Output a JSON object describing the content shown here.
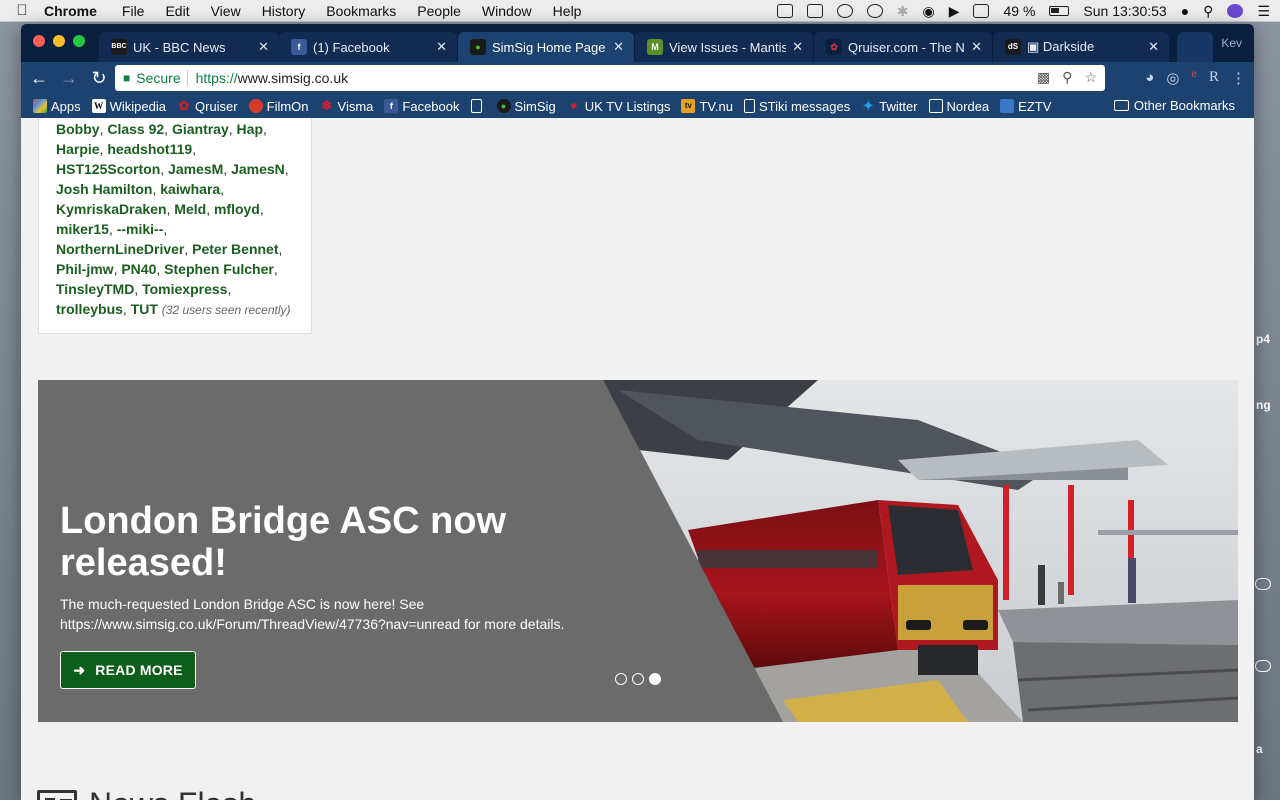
{
  "menubar": {
    "app": "Chrome",
    "items": [
      "File",
      "Edit",
      "View",
      "History",
      "Bookmarks",
      "People",
      "Window",
      "Help"
    ],
    "battery": "49 %",
    "clock": "Sun 13:30:53"
  },
  "tabs": [
    {
      "label": "UK - BBC News",
      "fav": "BBC",
      "color": "#1a1a1a"
    },
    {
      "label": "(1) Facebook",
      "fav": "f",
      "color": "#3b5998"
    },
    {
      "label": "SimSig Home Page | S",
      "fav": "●",
      "color": "#1a1a1a"
    },
    {
      "label": "View Issues - MantisB",
      "fav": "M",
      "color": "#5a8f2a"
    },
    {
      "label": "Qruiser.com - The No",
      "fav": "✿",
      "color": "#c0202a"
    },
    {
      "label": "▣ Darkside",
      "fav": "dS",
      "color": "#1a1a1a"
    }
  ],
  "profile": "Kev",
  "toolbar": {
    "secure": "Secure",
    "url_scheme": "https://",
    "url_rest": "www.simsig.co.uk"
  },
  "bookmarks": [
    {
      "label": "Apps",
      "icon": "apps-icon",
      "color": "#e04a3a"
    },
    {
      "label": "Wikipedia",
      "icon": "wikipedia-icon",
      "color": "#ffffff"
    },
    {
      "label": "Qruiser",
      "icon": "qruiser-icon",
      "color": "#c0202a"
    },
    {
      "label": "FilmOn",
      "icon": "filmon-icon",
      "color": "#d83a2a"
    },
    {
      "label": "Visma",
      "icon": "visma-icon",
      "color": "#d0203a"
    },
    {
      "label": "Facebook",
      "icon": "facebook-icon",
      "color": "#3b5998"
    },
    {
      "label": "",
      "icon": "page-icon",
      "color": "#1c4270"
    },
    {
      "label": "SimSig",
      "icon": "simsig-icon",
      "color": "#1a1a1a"
    },
    {
      "label": "UK TV Listings",
      "icon": "tv-listings-icon",
      "color": "#d0203a"
    },
    {
      "label": "TV.nu",
      "icon": "tvnu-icon",
      "color": "#e8a020"
    },
    {
      "label": "STiki messages",
      "icon": "page-icon",
      "color": "#1c4270"
    },
    {
      "label": "Twitter",
      "icon": "twitter-icon",
      "color": "#1da1f2"
    },
    {
      "label": "Nordea",
      "icon": "nordea-icon",
      "color": "#1c4270"
    },
    {
      "label": "EZTV",
      "icon": "eztv-icon",
      "color": "#3a78c8"
    }
  ],
  "other_bookmarks": "Other Bookmarks",
  "users": {
    "names": [
      "Bobby",
      "Class 92",
      "Giantray",
      "Hap",
      "Harpie",
      "headshot119",
      "HST125Scorton",
      "JamesM",
      "JamesN",
      "Josh Hamilton",
      "kaiwhara",
      "KymriskaDraken",
      "Meld",
      "mfloyd",
      "miker15",
      "--miki--",
      "NorthernLineDriver",
      "Peter Bennet",
      "Phil-jmw",
      "PN40",
      "Stephen Fulcher",
      "TinsleyTMD",
      "Tomiexpress",
      "trolleybus",
      "TUT"
    ],
    "seen_recently": "(32 users seen recently)"
  },
  "slide": {
    "title": "London Bridge ASC now released!",
    "text": "The much-requested London Bridge ASC is now here! See https://www.simsig.co.uk/Forum/ThreadView/47736?nav=unread for more details.",
    "button": "READ MORE",
    "active_dot": 3
  },
  "news": {
    "heading": "News Flash"
  },
  "desktop": {
    "fragments": [
      "p4",
      "ng",
      "a"
    ]
  }
}
